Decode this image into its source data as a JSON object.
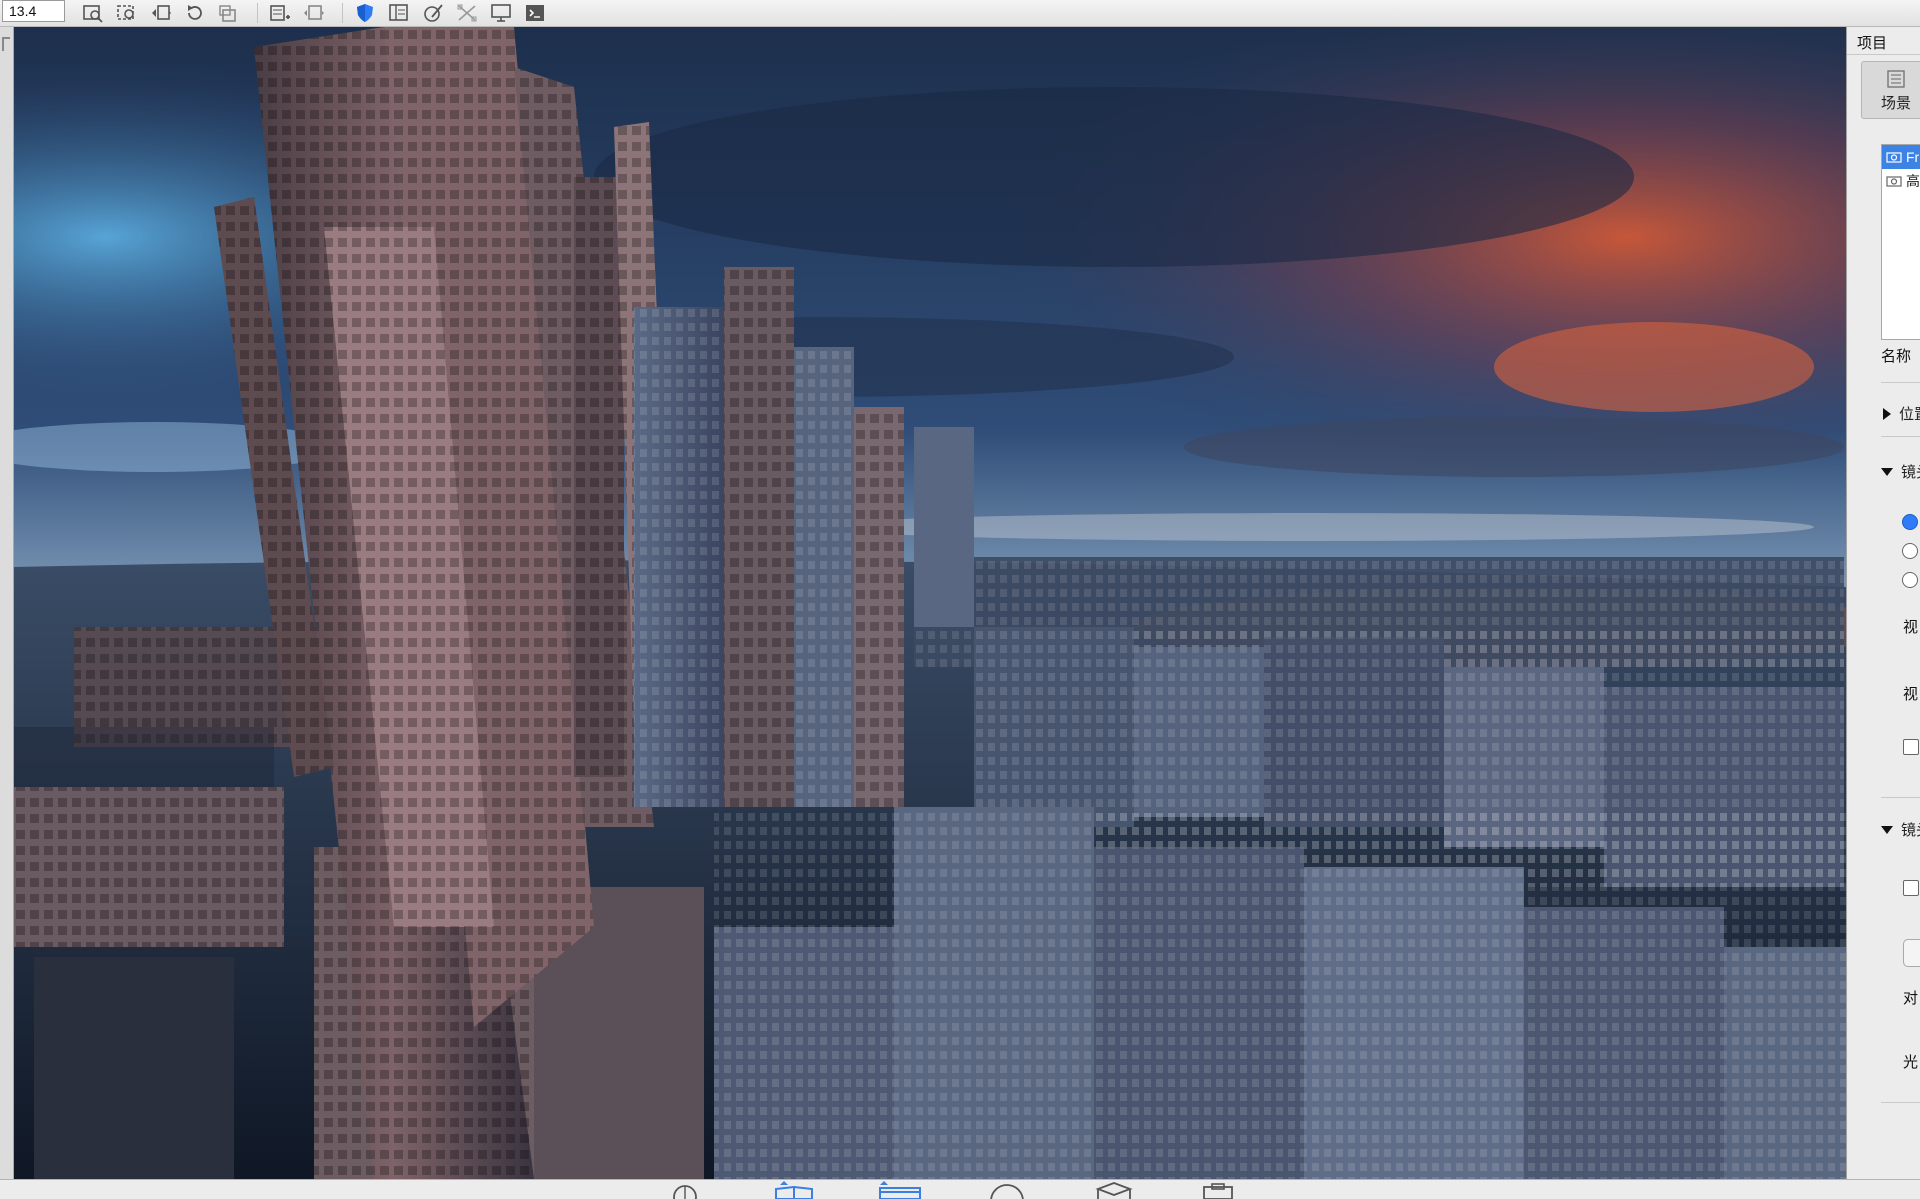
{
  "toolbar": {
    "zoom_value": "13.4"
  },
  "right_panel": {
    "panel_title": "项目",
    "scene_tab_label": "场景",
    "scenes": [
      {
        "label": "Fr",
        "selected": true
      },
      {
        "label": "高",
        "selected": false
      }
    ],
    "name_label": "名称",
    "section_position": "位置",
    "section_lens": "镜头",
    "label_view_1": "视",
    "label_view_2": "视",
    "section_lens_2": "镜头",
    "label_focus": "对",
    "label_aperture": "光"
  },
  "colors": {
    "accent": "#3d83e6",
    "sky_blue": "#2a4a78",
    "sunset_orange": "#d4623a"
  }
}
